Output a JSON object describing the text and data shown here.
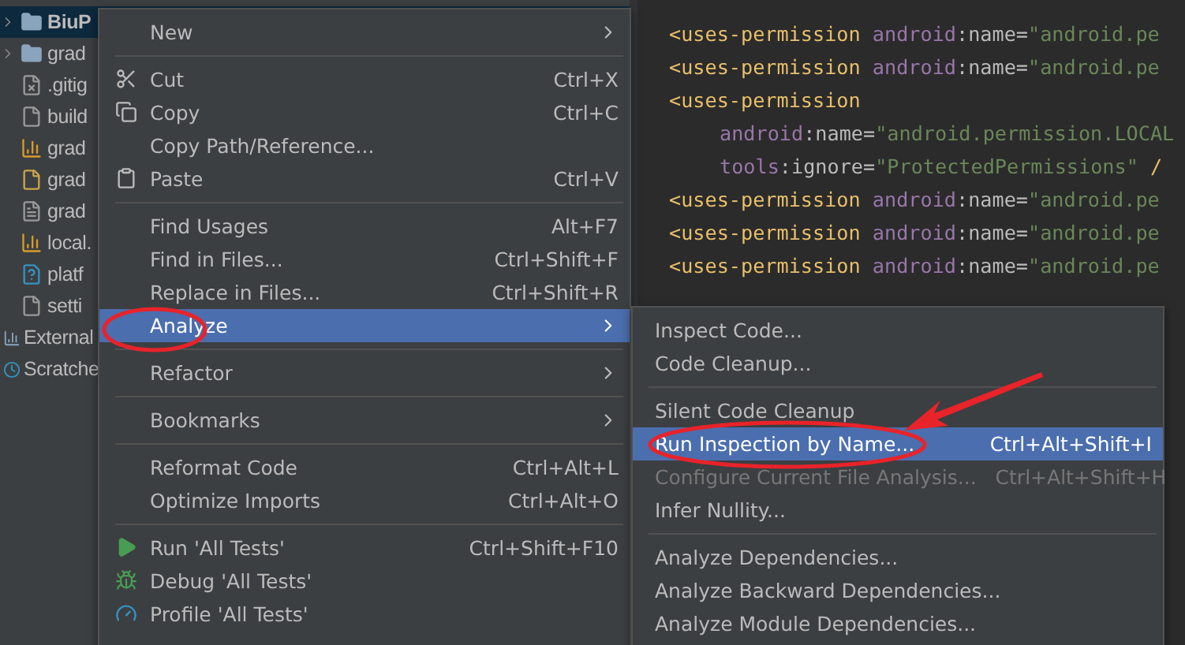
{
  "tree": {
    "items": [
      {
        "label": "BiuP",
        "kind": "project",
        "expandable": true,
        "selected": true
      },
      {
        "label": "grad",
        "kind": "folder",
        "expandable": true,
        "selected": false
      },
      {
        "label": ".gitig",
        "kind": "ignore",
        "expandable": false,
        "selected": false
      },
      {
        "label": "build",
        "kind": "gradle",
        "expandable": false,
        "selected": false
      },
      {
        "label": "grad",
        "kind": "props",
        "expandable": false,
        "selected": false
      },
      {
        "label": "grad",
        "kind": "script",
        "expandable": false,
        "selected": false
      },
      {
        "label": "grad",
        "kind": "text",
        "expandable": false,
        "selected": false
      },
      {
        "label": "local.",
        "kind": "props",
        "expandable": false,
        "selected": false
      },
      {
        "label": "platf",
        "kind": "unknown",
        "expandable": false,
        "selected": false
      },
      {
        "label": "setti",
        "kind": "gradle",
        "expandable": false,
        "selected": false
      },
      {
        "label": "External",
        "kind": "libraries",
        "expandable": false,
        "selected": false
      },
      {
        "label": "Scratche",
        "kind": "scratches",
        "expandable": false,
        "selected": false
      }
    ]
  },
  "editor": {
    "lines": [
      {
        "indent": false,
        "tokens": [
          {
            "text": "<uses-permission ",
            "kind": "tag"
          },
          {
            "text": "android",
            "kind": "ns"
          },
          {
            "text": ":name=",
            "kind": "attr"
          },
          {
            "text": "\"android.pe",
            "kind": "value"
          }
        ]
      },
      {
        "indent": false,
        "tokens": [
          {
            "text": "<uses-permission ",
            "kind": "tag"
          },
          {
            "text": "android",
            "kind": "ns"
          },
          {
            "text": ":name=",
            "kind": "attr"
          },
          {
            "text": "\"android.pe",
            "kind": "value"
          }
        ]
      },
      {
        "indent": false,
        "tokens": [
          {
            "text": "<uses-permission",
            "kind": "tag"
          }
        ]
      },
      {
        "indent": true,
        "tokens": [
          {
            "text": "android",
            "kind": "ns"
          },
          {
            "text": ":name=",
            "kind": "attr"
          },
          {
            "text": "\"android.permission.LOCAL",
            "kind": "value"
          }
        ]
      },
      {
        "indent": true,
        "tokens": [
          {
            "text": "tools",
            "kind": "ns"
          },
          {
            "text": ":ignore=",
            "kind": "attr"
          },
          {
            "text": "\"ProtectedPermissions\"",
            "kind": "value"
          },
          {
            "text": " /",
            "kind": "tag"
          }
        ]
      },
      {
        "indent": false,
        "tokens": [
          {
            "text": "<uses-permission ",
            "kind": "tag"
          },
          {
            "text": "android",
            "kind": "ns"
          },
          {
            "text": ":name=",
            "kind": "attr"
          },
          {
            "text": "\"android.pe",
            "kind": "value"
          }
        ]
      },
      {
        "indent": false,
        "tokens": [
          {
            "text": "<uses-permission ",
            "kind": "tag"
          },
          {
            "text": "android",
            "kind": "ns"
          },
          {
            "text": ":name=",
            "kind": "attr"
          },
          {
            "text": "\"android.pe",
            "kind": "value"
          }
        ]
      },
      {
        "indent": false,
        "tokens": [
          {
            "text": "<uses-permission ",
            "kind": "tag"
          },
          {
            "text": "android",
            "kind": "ns"
          },
          {
            "text": ":name=",
            "kind": "attr"
          },
          {
            "text": "\"android.pe",
            "kind": "value"
          }
        ]
      }
    ]
  },
  "context_menu": {
    "items": [
      {
        "kind": "item",
        "label": "New",
        "submenu": true,
        "selected": false
      },
      {
        "kind": "separator"
      },
      {
        "kind": "item",
        "label": "Cut",
        "shortcut": "Ctrl+X",
        "selected": false
      },
      {
        "kind": "item",
        "label": "Copy",
        "shortcut": "Ctrl+C",
        "selected": false
      },
      {
        "kind": "item",
        "label": "Copy Path/Reference...",
        "selected": false
      },
      {
        "kind": "item",
        "label": "Paste",
        "shortcut": "Ctrl+V",
        "selected": false
      },
      {
        "kind": "separator"
      },
      {
        "kind": "item",
        "label": "Find Usages",
        "shortcut": "Alt+F7",
        "selected": false
      },
      {
        "kind": "item",
        "label": "Find in Files...",
        "shortcut": "Ctrl+Shift+F",
        "selected": false
      },
      {
        "kind": "item",
        "label": "Replace in Files...",
        "shortcut": "Ctrl+Shift+R",
        "selected": false
      },
      {
        "kind": "item",
        "label": "Analyze",
        "submenu": true,
        "selected": true
      },
      {
        "kind": "separator"
      },
      {
        "kind": "item",
        "label": "Refactor",
        "submenu": true,
        "selected": false
      },
      {
        "kind": "separator"
      },
      {
        "kind": "item",
        "label": "Bookmarks",
        "submenu": true,
        "selected": false
      },
      {
        "kind": "separator"
      },
      {
        "kind": "item",
        "label": "Reformat Code",
        "shortcut": "Ctrl+Alt+L",
        "selected": false
      },
      {
        "kind": "item",
        "label": "Optimize Imports",
        "shortcut": "Ctrl+Alt+O",
        "selected": false
      },
      {
        "kind": "separator"
      },
      {
        "kind": "item",
        "label": "Run 'All Tests'",
        "shortcut": "Ctrl+Shift+F10",
        "selected": false
      },
      {
        "kind": "item",
        "label": "Debug 'All Tests'",
        "selected": false
      },
      {
        "kind": "item",
        "label": "Profile 'All Tests'",
        "selected": false
      }
    ]
  },
  "submenu": {
    "items": [
      {
        "kind": "item",
        "label": "Inspect Code...",
        "selected": false,
        "disabled": false
      },
      {
        "kind": "item",
        "label": "Code Cleanup...",
        "selected": false,
        "disabled": false
      },
      {
        "kind": "separator"
      },
      {
        "kind": "item",
        "label": "Silent Code Cleanup",
        "selected": false,
        "disabled": false
      },
      {
        "kind": "item",
        "label": "Run Inspection by Name...",
        "shortcut": "Ctrl+Alt+Shift+I",
        "selected": true,
        "disabled": false
      },
      {
        "kind": "item",
        "label": "Configure Current File Analysis...",
        "shortcut": "Ctrl+Alt+Shift+H",
        "selected": false,
        "disabled": true
      },
      {
        "kind": "item",
        "label": "Infer Nullity...",
        "selected": false,
        "disabled": false
      },
      {
        "kind": "separator"
      },
      {
        "kind": "item",
        "label": "Analyze Dependencies...",
        "selected": false,
        "disabled": false
      },
      {
        "kind": "item",
        "label": "Analyze Backward Dependencies...",
        "selected": false,
        "disabled": false
      },
      {
        "kind": "item",
        "label": "Analyze Module Dependencies...",
        "selected": false,
        "disabled": false
      }
    ]
  }
}
